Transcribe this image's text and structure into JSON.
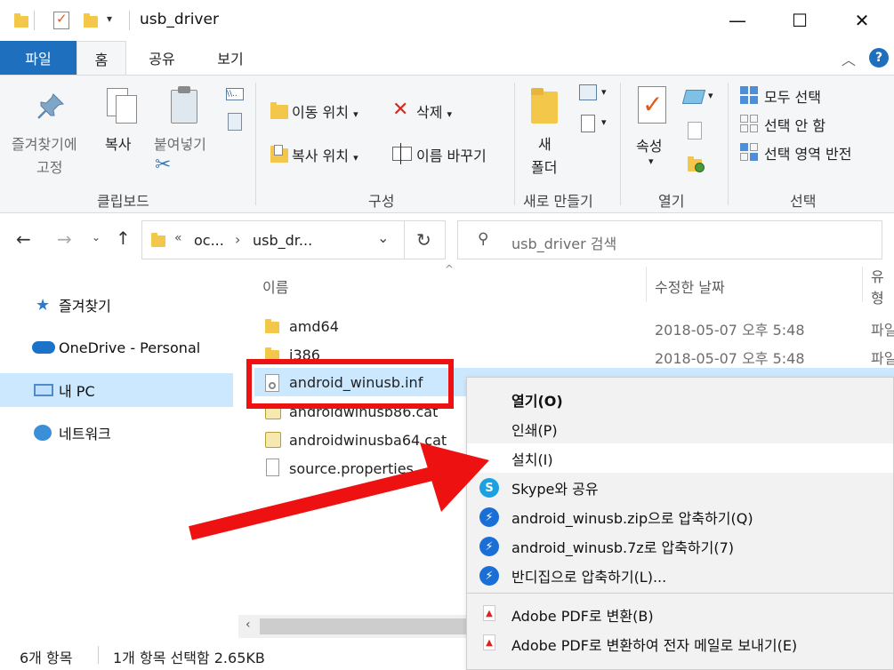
{
  "window": {
    "title": "usb_driver"
  },
  "ribbon_tabs": [
    "파일",
    "홈",
    "공유",
    "보기"
  ],
  "ribbon": {
    "clipboard": {
      "pin_label_line1": "즐겨찾기에",
      "pin_label_line2": "고정",
      "copy_label": "복사",
      "paste_label": "붙여넣기",
      "group_label": "클립보드"
    },
    "organize": {
      "move_label": "이동 위치",
      "copy_to_label": "복사 위치",
      "delete_label": "삭제",
      "rename_label": "이름 바꾸기",
      "group_label": "구성"
    },
    "new": {
      "new_folder_line1": "새",
      "new_folder_line2": "폴더",
      "group_label": "새로 만들기"
    },
    "open": {
      "properties_label": "속성",
      "group_label": "열기"
    },
    "select": {
      "select_all": "모두 선택",
      "select_none": "선택 안 함",
      "invert": "선택 영역 반전",
      "group_label": "선택"
    }
  },
  "address": {
    "crumb_overflow": "«",
    "crumb1": "oc...",
    "crumb_sep": "›",
    "crumb2": "usb_dr...",
    "search_placeholder": "usb_driver 검색"
  },
  "nav": {
    "items": [
      {
        "label": "즐겨찾기"
      },
      {
        "label": "OneDrive - Personal"
      },
      {
        "label": "내 PC"
      },
      {
        "label": "네트워크"
      }
    ]
  },
  "columns": {
    "name": "이름",
    "date": "수정한 날짜",
    "type": "유형"
  },
  "files": [
    {
      "name": "amd64",
      "date": "2018-05-07 오후 5:48",
      "type": "파일"
    },
    {
      "name": "i386",
      "date": "2018-05-07 오후 5:48",
      "type": "파일"
    },
    {
      "name": "android_winusb.inf",
      "date": "",
      "type": ""
    },
    {
      "name": "androidwinusb86.cat",
      "date": "",
      "type": ""
    },
    {
      "name": "androidwinusba64.cat",
      "date": "",
      "type": ""
    },
    {
      "name": "source.properties",
      "date": "",
      "type": ""
    }
  ],
  "status": {
    "count": "6개 항목",
    "selection": "1개 항목 선택함 2.65KB"
  },
  "context_menu": {
    "items": [
      {
        "label": "열기(O)"
      },
      {
        "label": "인쇄(P)"
      },
      {
        "label": "설치(I)"
      },
      {
        "label": "Skype와 공유"
      },
      {
        "label": "android_winusb.zip으로 압축하기(Q)"
      },
      {
        "label": "android_winusb.7z로 압축하기(7)"
      },
      {
        "label": "반디집으로 압축하기(L)..."
      },
      {
        "label": "Adobe PDF로 변환(B)"
      },
      {
        "label": "Adobe PDF로 변환하여 전자 메일로 보내기(E)"
      }
    ]
  },
  "colors": {
    "file_tab": "#1f6fbf",
    "selection": "#cce8ff",
    "annotation_red": "#ee1111"
  }
}
